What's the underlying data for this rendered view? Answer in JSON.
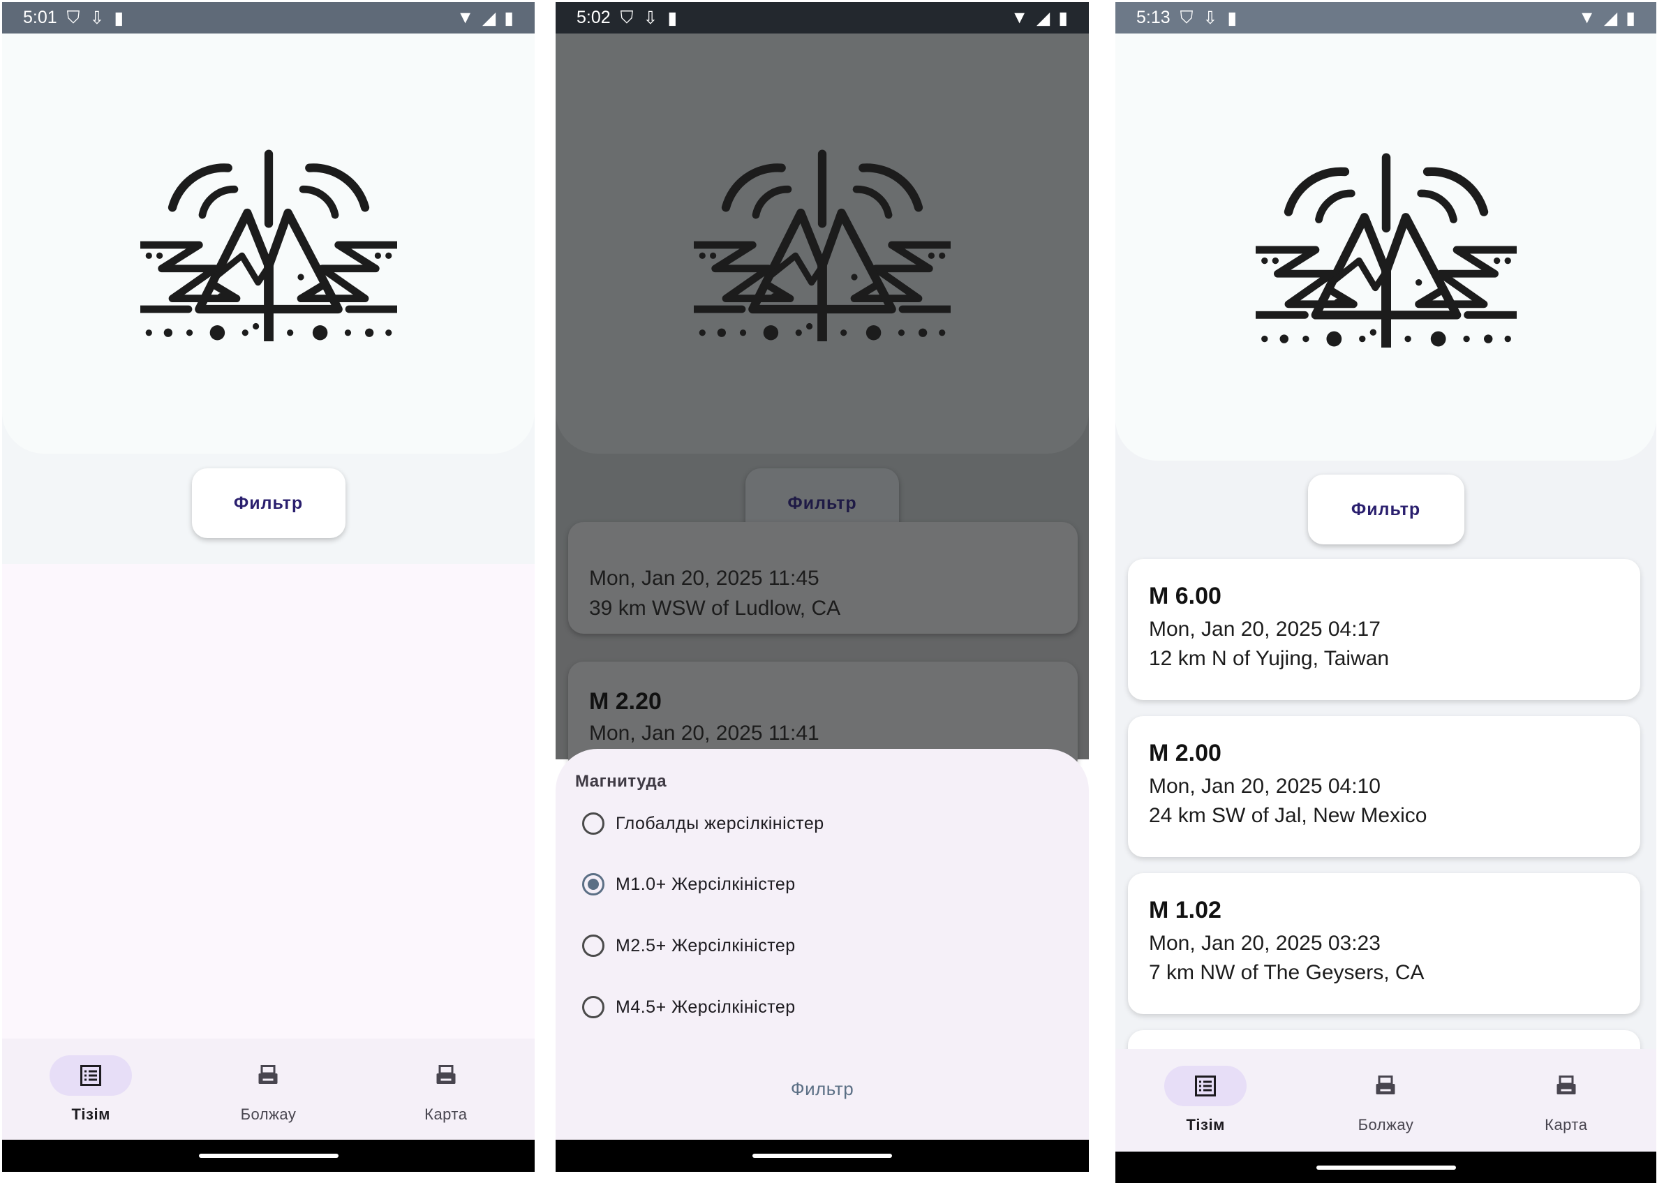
{
  "screens": [
    {
      "status": {
        "time": "5:01"
      },
      "filter_button": "Фильтр",
      "nav": [
        {
          "label": "Тізім",
          "icon": "list-icon",
          "active": true
        },
        {
          "label": "Болжау",
          "icon": "fax-icon",
          "active": false
        },
        {
          "label": "Карта",
          "icon": "fax-icon",
          "active": false
        }
      ]
    },
    {
      "status": {
        "time": "5:02"
      },
      "filter_button": "Фильтр",
      "list_partial": [
        {
          "date": "Mon, Jan 20, 2025  11:45",
          "place": "39 km WSW of Ludlow, CA"
        },
        {
          "magnitude": "M 2.20",
          "date": "Mon, Jan 20, 2025  11:41"
        }
      ],
      "sheet": {
        "title": "Магнитуда",
        "options": [
          {
            "label": "Глобалды жерсілкіністер",
            "selected": false
          },
          {
            "label": "M1.0+ Жерсілкіністер",
            "selected": true
          },
          {
            "label": "M2.5+ Жерсілкіністер",
            "selected": false
          },
          {
            "label": "M4.5+ Жерсілкіністер",
            "selected": false
          }
        ],
        "action": "Фильтр"
      }
    },
    {
      "status": {
        "time": "5:13"
      },
      "filter_button": "Фильтр",
      "earthquakes": [
        {
          "magnitude": "M 6.00",
          "date": "Mon, Jan 20, 2025  04:17",
          "place": "12 km N of Yujing, Taiwan"
        },
        {
          "magnitude": "M 2.00",
          "date": "Mon, Jan 20, 2025  04:10",
          "place": "24 km SW of Jal, New Mexico"
        },
        {
          "magnitude": "M 1.02",
          "date": "Mon, Jan 20, 2025  03:23",
          "place": "7 km NW of The Geysers, CA"
        }
      ],
      "nav": [
        {
          "label": "Тізім",
          "icon": "list-icon",
          "active": true
        },
        {
          "label": "Болжау",
          "icon": "fax-icon",
          "active": false
        },
        {
          "label": "Карта",
          "icon": "fax-icon",
          "active": false
        }
      ]
    }
  ],
  "colors": {
    "status_bar_1": "#5f6a78",
    "status_bar_2": "#23282e",
    "status_bar_3": "#6d7988",
    "nav_active_pill": "#e7def7",
    "scrim": "#6a6d6e",
    "sheet_bg": "#f5f0f8",
    "radio_selected": "#5b6f85",
    "filter_text": "#2a1f6e"
  }
}
